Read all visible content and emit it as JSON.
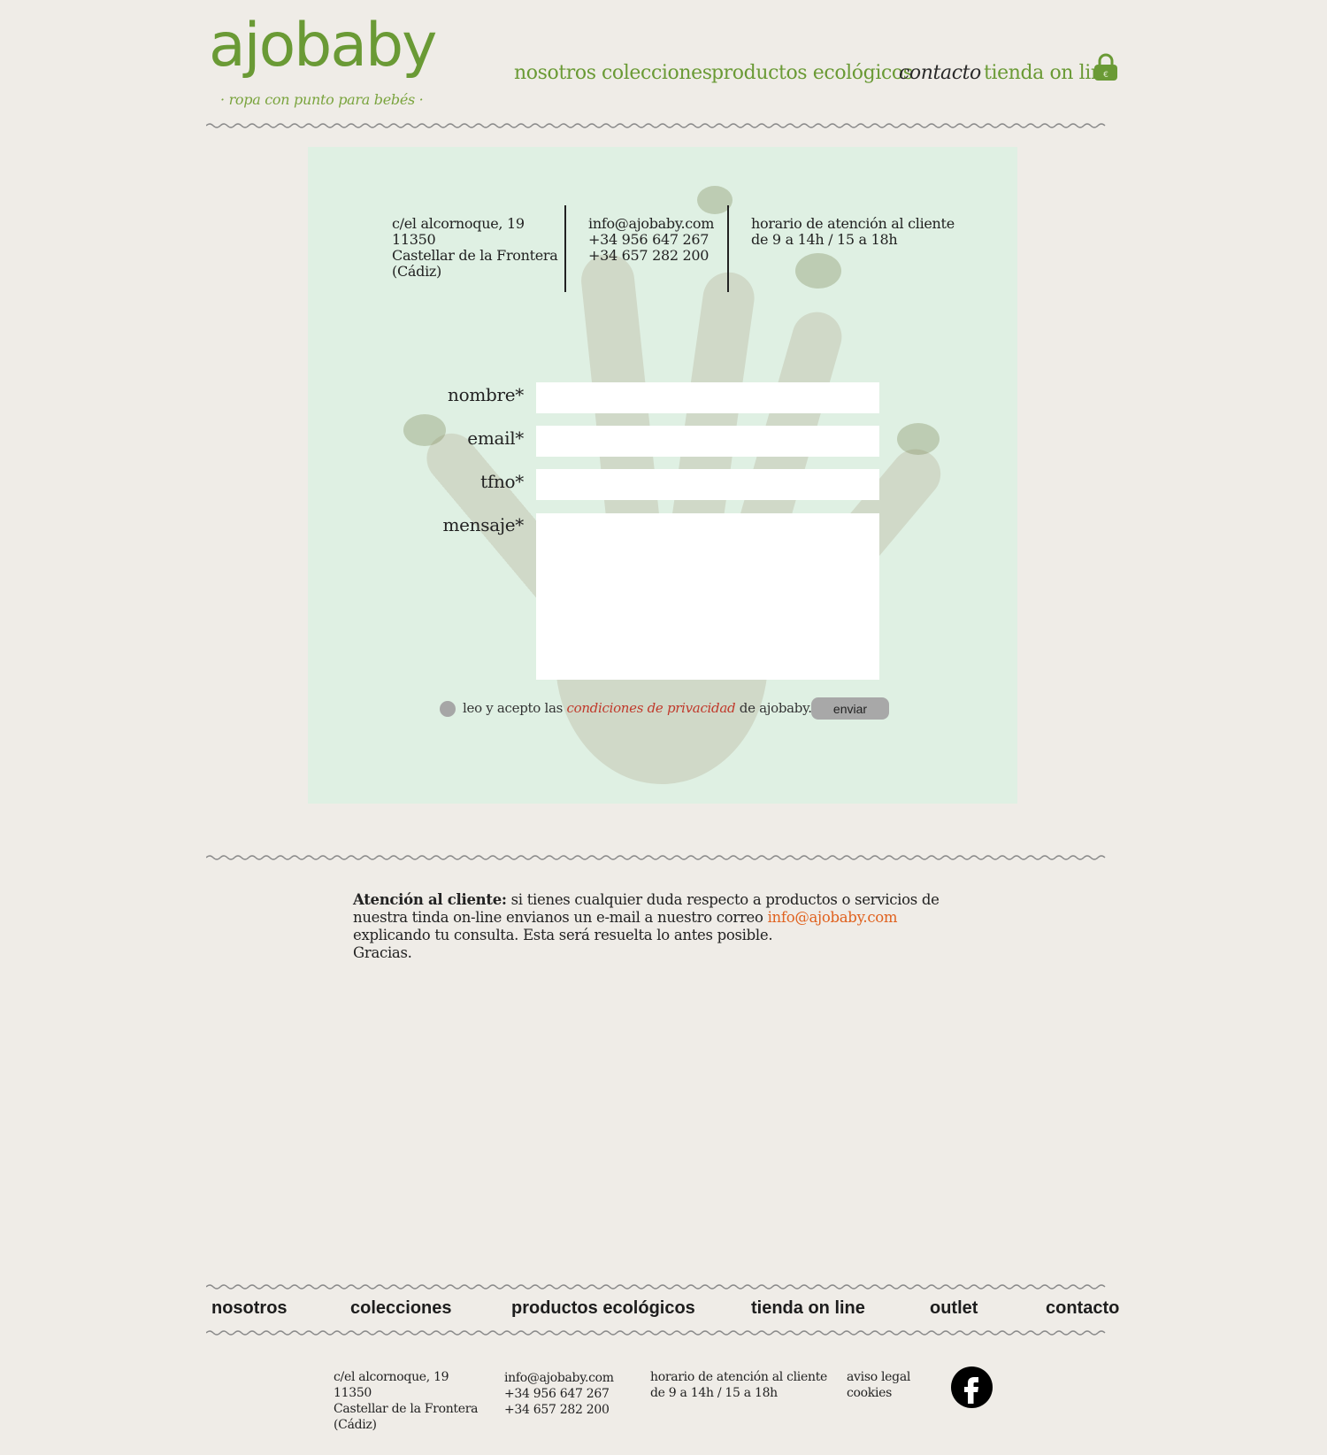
{
  "brand": {
    "logo_text": "ajobaby",
    "tagline": "· ropa con punto para bebés ·",
    "color": "#6a9a35"
  },
  "nav": {
    "items": [
      {
        "label": "nosotros"
      },
      {
        "label": "colecciones"
      },
      {
        "label": "productos ecológicos"
      },
      {
        "label": "contacto",
        "active": true
      },
      {
        "label": "tienda on line"
      }
    ],
    "cart_icon": "shopping-bag-icon"
  },
  "contact_info": {
    "address": [
      "c/el alcornoque, 19",
      "11350",
      "Castellar de la Frontera",
      "(Cádiz)"
    ],
    "contact": [
      "info@ajobaby.com",
      "+34 956 647 267",
      "+34 657 282 200"
    ],
    "hours": [
      "horario de atención al cliente",
      "de 9 a 14h / 15 a 18h"
    ]
  },
  "form": {
    "name_label": "nombre*",
    "email_label": "email*",
    "phone_label": "tfno*",
    "message_label": "mensaje*",
    "name_value": "",
    "email_value": "",
    "phone_value": "",
    "message_value": "",
    "consent_prefix": "leo y acepto las",
    "consent_link": "condiciones de privacidad",
    "consent_suffix": "de ajobaby.com*",
    "submit_label": "enviar"
  },
  "service": {
    "heading": "Atención  al cliente:",
    "text_before": " si tienes cualquier duda respecto a productos o servicios de nuestra tinda on-line envianos un e-mail a nuestro correo ",
    "email": "info@ajobaby.com",
    "text_after": " explicando tu consulta. Esta será resuelta lo antes posible.",
    "thanks": "Gracias."
  },
  "footer": {
    "nav": [
      {
        "label": "nosotros"
      },
      {
        "label": "colecciones"
      },
      {
        "label": "productos ecológicos"
      },
      {
        "label": "tienda on line"
      },
      {
        "label": "outlet"
      },
      {
        "label": "contacto"
      }
    ],
    "address": [
      "c/el alcornoque, 19",
      "11350",
      "Castellar de la Frontera",
      "(Cádiz)"
    ],
    "contact": [
      "info@ajobaby.com",
      "+34 956 647 267",
      "+34 657 282 200"
    ],
    "hours": [
      "horario de atención al cliente",
      "de 9 a 14h / 15 a 18h"
    ],
    "legal": [
      "aviso legal",
      "cookies"
    ],
    "social_icon": "facebook-icon"
  },
  "colors": {
    "accent_green": "#6a9a35",
    "panel_mint": "#dff0e3",
    "link_red": "#c0392b",
    "email_orange": "#e0621f"
  }
}
